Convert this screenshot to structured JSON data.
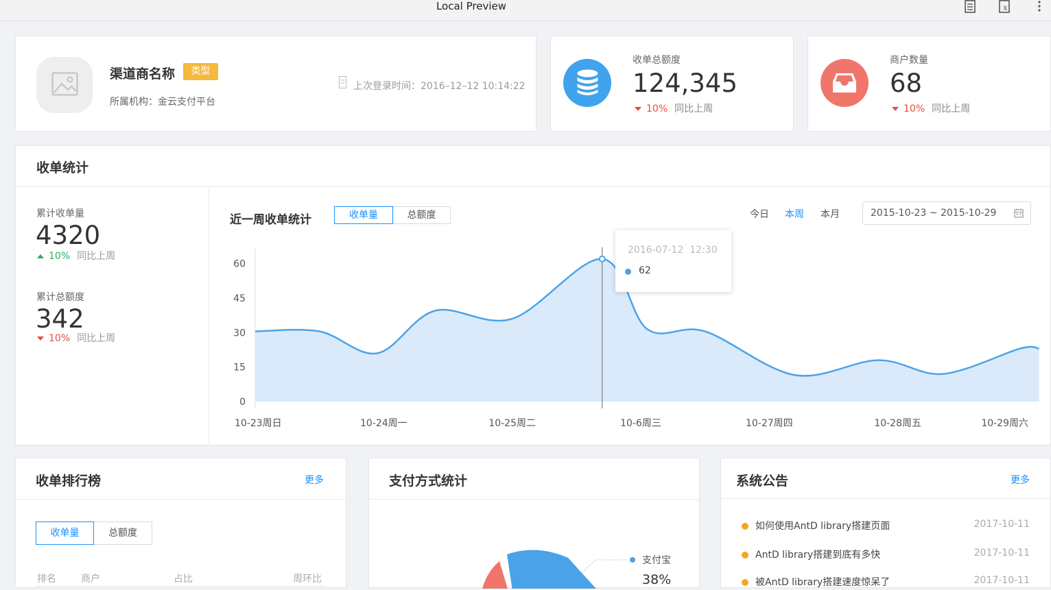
{
  "window": {
    "title": "Local Preview"
  },
  "profile": {
    "name": "渠道商名称",
    "type_badge": "类型",
    "org": "所属机构：金云支付平台",
    "last_login": "上次登录时间：2016–12–12 10:14:22"
  },
  "stat_cards": [
    {
      "label": "收单总额度",
      "value": "124,345",
      "change": "10%",
      "compare": "同比上周",
      "icon": "database-icon",
      "color": "#3fa3ee"
    },
    {
      "label": "商户数量",
      "value": "68",
      "change": "10%",
      "compare": "同比上周",
      "icon": "inbox-icon",
      "color": "#f0766b"
    }
  ],
  "collection": {
    "title": "收单统计",
    "metrics": [
      {
        "label": "累计收单量",
        "value": "4320",
        "change": "10%",
        "direction": "up",
        "compare": "同比上周"
      },
      {
        "label": "累计总额度",
        "value": "342",
        "change": "10%",
        "direction": "down",
        "compare": "同比上周"
      }
    ],
    "chart_title": "近一周收单统计",
    "tabs": [
      "收单量",
      "总额度"
    ],
    "ranges": [
      "今日",
      "本周",
      "本月"
    ],
    "date_range": "2015-10-23 ~ 2015-10-29",
    "tooltip": {
      "time": "2016-07-12  12:30",
      "value": "62"
    }
  },
  "chart_data": {
    "type": "area",
    "x": [
      "10-23周日",
      "10-24周一",
      "10-25周二",
      "10-6周三",
      "10-27周四",
      "10-28周五",
      "10-29周六"
    ],
    "y_ticks": [
      0,
      15,
      30,
      45,
      60
    ],
    "ylim": [
      0,
      70
    ],
    "series": [
      {
        "values": [
          [
            0,
            30.5
          ],
          [
            0.5,
            30.5
          ],
          [
            0.95,
            21
          ],
          [
            1.4,
            39.5
          ],
          [
            2.0,
            36
          ],
          [
            2.7,
            62
          ],
          [
            3.05,
            31.5
          ],
          [
            3.5,
            30.5
          ],
          [
            4.2,
            11.5
          ],
          [
            4.85,
            18
          ],
          [
            5.35,
            12
          ],
          [
            5.95,
            23
          ],
          [
            6.1,
            23
          ]
        ]
      }
    ],
    "grid": false,
    "area_color": "#dbeafa",
    "line_color": "#4aa3e8"
  },
  "ranking": {
    "title": "收单排行榜",
    "more": "更多",
    "tabs": [
      "收单量",
      "总额度"
    ],
    "columns": [
      "排名",
      "商户",
      "占比",
      "周环比"
    ]
  },
  "payment": {
    "title": "支付方式统计",
    "legend": [
      {
        "name": "支付宝",
        "pct": "38%"
      }
    ]
  },
  "notices": {
    "title": "系统公告",
    "more": "更多",
    "items": [
      {
        "text": "如何使用AntD library搭建页面",
        "date": "2017-10-11"
      },
      {
        "text": "AntD library搭建到底有多快",
        "date": "2017-10-11"
      },
      {
        "text": "被AntD library搭建速度惊呆了",
        "date": "2017-10-11"
      }
    ]
  }
}
